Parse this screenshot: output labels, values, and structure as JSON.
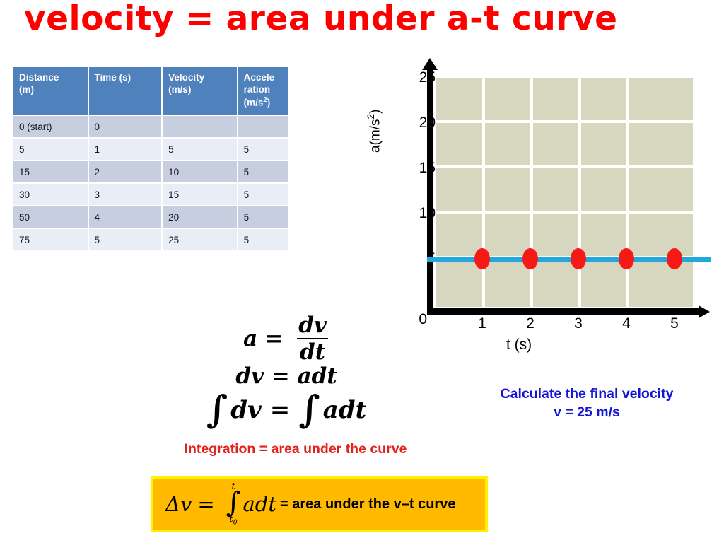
{
  "slide": {
    "title": "velocity = area under a-t curve",
    "title_color": "#FF0000"
  },
  "table": {
    "headers": [
      "Distance (m)",
      "Time (s)",
      "Velocity (m/s)",
      "Accele ration (m/s2)"
    ],
    "header_parts": {
      "h0_line1": "Distance",
      "h0_line2": "(m)",
      "h1_line1": "Time (s)",
      "h2_line1": "Velocity",
      "h2_line2": "(m/s)",
      "h3_line1": "Accele",
      "h3_line2": "ration",
      "h3_line3_pre": "(m/s",
      "h3_line3_sup": "2",
      "h3_line3_post": ")"
    },
    "header_bg": "#4F81BD",
    "row_bg_odd": "#C6CEDF",
    "row_bg_even": "#E9EDF5",
    "rows": [
      [
        "0 (start)",
        "0",
        "",
        ""
      ],
      [
        "5",
        "1",
        "5",
        "5"
      ],
      [
        "15",
        "2",
        "10",
        "5"
      ],
      [
        "30",
        "3",
        "15",
        "5"
      ],
      [
        "50",
        "4",
        "20",
        "5"
      ],
      [
        "75",
        "5",
        "25",
        "5"
      ]
    ]
  },
  "chart_data": {
    "type": "scatter",
    "title": "",
    "xlabel": "t (s)",
    "ylabel": "a(m/s2)",
    "ylabel_parts": {
      "pre": "a(m/s",
      "sup": "2",
      "post": ")"
    },
    "x": [
      1,
      2,
      3,
      4,
      5
    ],
    "series": [
      {
        "name": "acceleration",
        "values": [
          5,
          5,
          5,
          5,
          5
        ],
        "color": "#F51A16",
        "line_color": "#22A8DD"
      }
    ],
    "xlim": [
      0,
      5.6
    ],
    "ylim": [
      0,
      27
    ],
    "x_ticks": [
      "1",
      "2",
      "3",
      "4",
      "5"
    ],
    "y_ticks": [
      "25",
      "20",
      "15",
      "10",
      "5",
      "0"
    ],
    "grid": true,
    "plot_bg": "#D7D6BE",
    "grid_color": "#FFFFFF",
    "legend": "none"
  },
  "chart_caption": {
    "line1": "Calculate the final velocity",
    "line2": "v = 25 m/s",
    "color": "#1515D8"
  },
  "equations": {
    "eq1": {
      "lhs": "a",
      "eq": "=",
      "num": "dv",
      "den": "dt"
    },
    "eq2": "dv = adt",
    "eq3": {
      "int1": "∫",
      "t1": "dv",
      "eq": "=",
      "int2": "∫",
      "t2": "adt"
    },
    "note": "Integration = area under the curve",
    "note_color": "#E2211C"
  },
  "highlight": {
    "delta_v": "Δv",
    "equals": "=",
    "integral_upper": "t",
    "integral_lower_base": "t",
    "integral_lower_sub": "0",
    "integrand": "adt",
    "text": "= area under the v–t curve",
    "fill": "#FFBA00",
    "border": "#FFF200"
  }
}
